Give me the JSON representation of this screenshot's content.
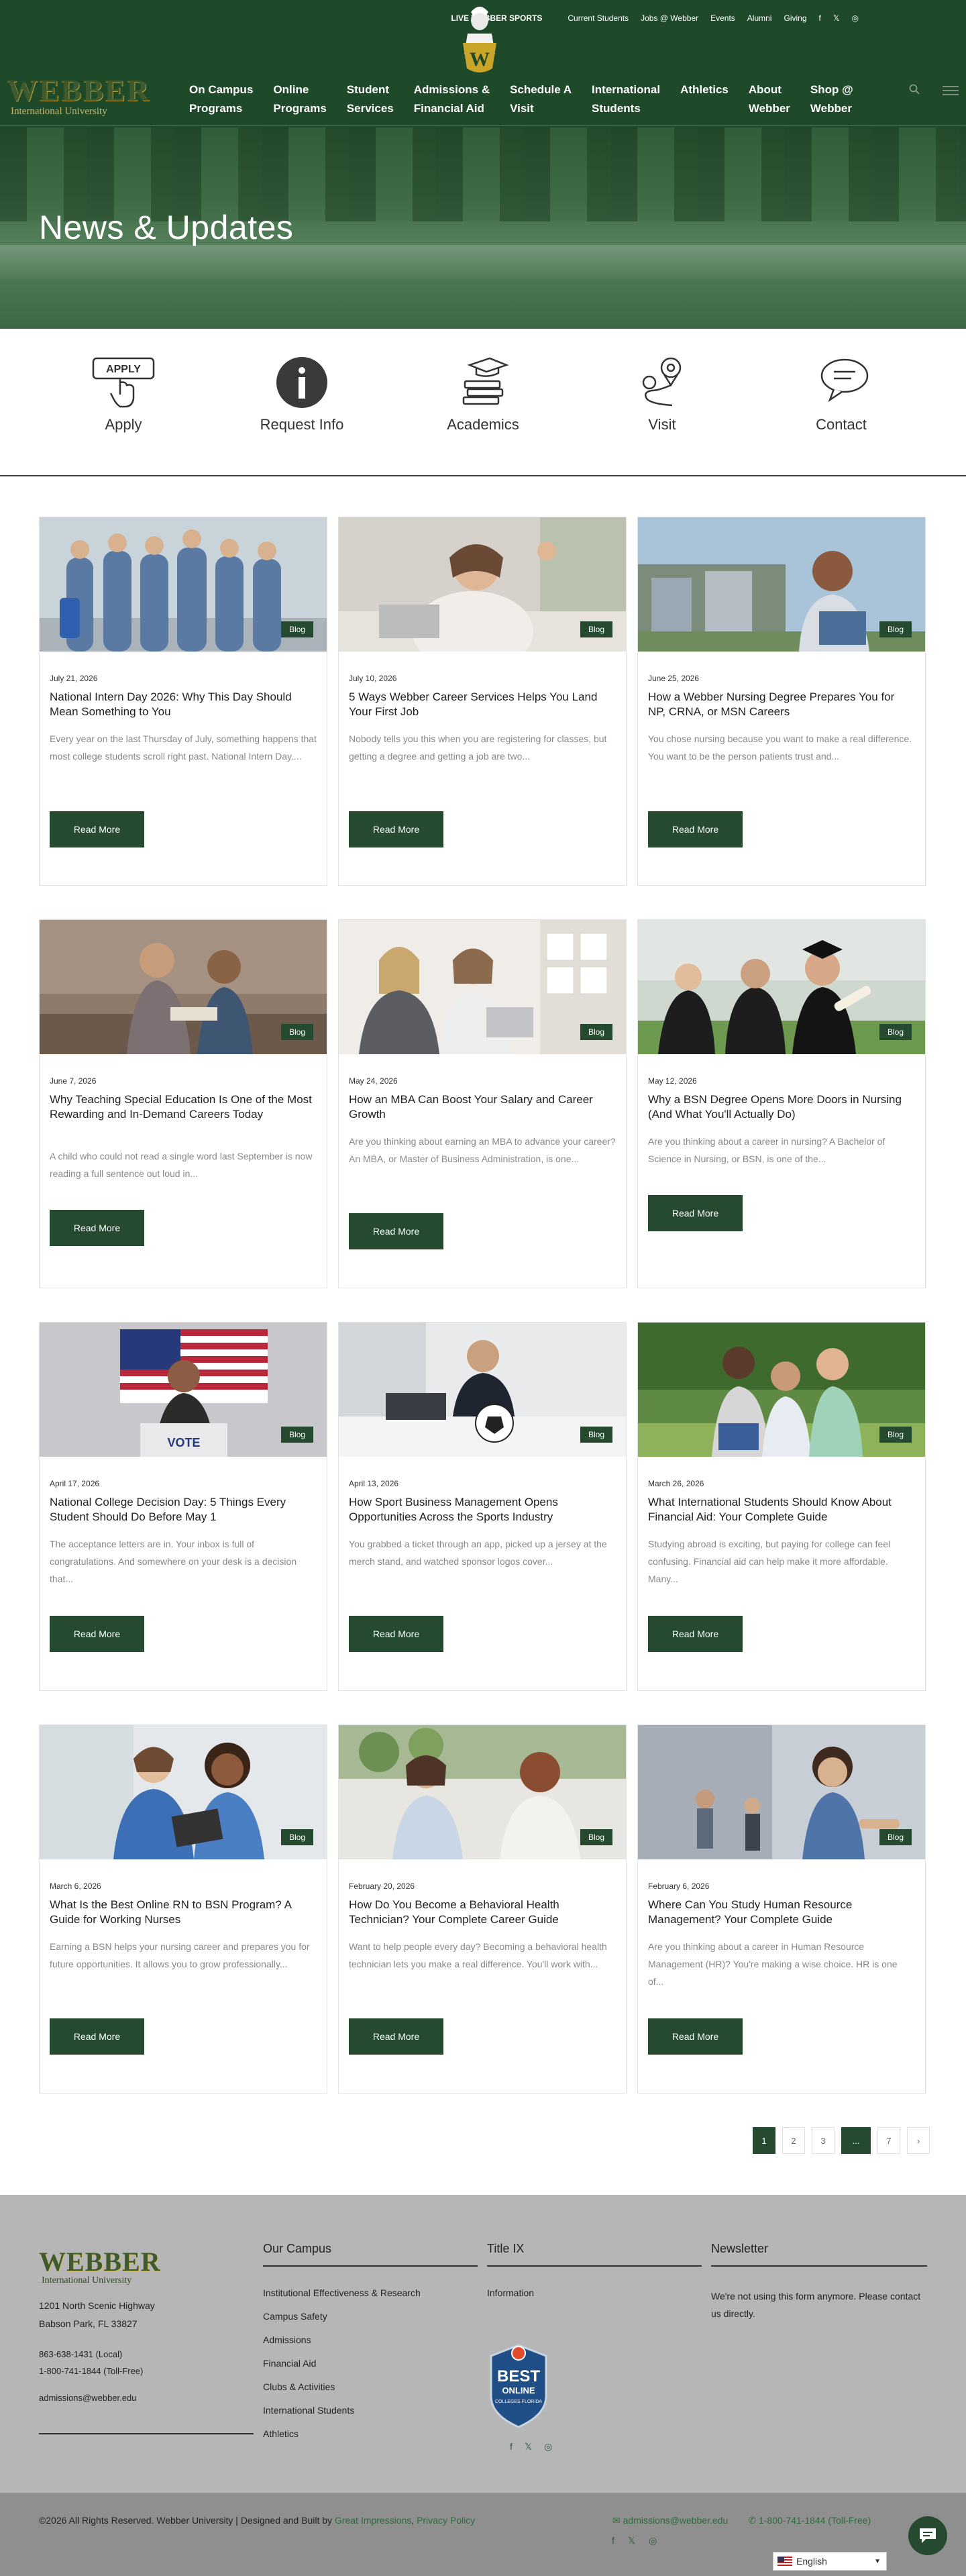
{
  "topbar": {
    "live": "LIVE WEBBER SPORTS",
    "links": [
      "Current Students",
      "Jobs @ Webber",
      "Events",
      "Alumni",
      "Giving"
    ],
    "social": [
      "facebook-icon",
      "twitter-icon",
      "instagram-icon"
    ]
  },
  "logo": {
    "name": "WEBBER",
    "subtitle": "International University"
  },
  "nav": {
    "items": [
      "On Campus\nPrograms",
      "Online\nPrograms",
      "Student\nServices",
      "Admissions &\nFinancial Aid",
      "Schedule A\nVisit",
      "International\nStudents",
      "Athletics",
      "About\nWebber",
      "Shop @\nWebber"
    ]
  },
  "hero": {
    "title": "News & Updates"
  },
  "quick_links": [
    {
      "label": "Apply",
      "icon": "apply-hand-icon",
      "badge": "APPLY"
    },
    {
      "label": "Request Info",
      "icon": "info-icon"
    },
    {
      "label": "Academics",
      "icon": "books-mortarboard-icon"
    },
    {
      "label": "Visit",
      "icon": "map-pin-icon"
    },
    {
      "label": "Contact",
      "icon": "chat-bubbles-icon"
    }
  ],
  "cards": [
    {
      "date": "July 21, 2026",
      "title": "National Intern Day 2026: Why This Day Should Mean Something to You",
      "excerpt": "Every year on the last Thursday of July, something happens that most college students scroll right past. National Intern Day....",
      "tag": "Blog",
      "button": "Read More"
    },
    {
      "date": "July 10, 2026",
      "title": "5 Ways Webber Career Services Helps You Land Your First Job",
      "excerpt": "Nobody tells you this when you are registering for classes, but getting a degree and getting a job are two...",
      "tag": "Blog",
      "button": "Read More"
    },
    {
      "date": "June 25, 2026",
      "title": "How a Webber Nursing Degree Prepares You for NP, CRNA, or MSN Careers",
      "excerpt": "You chose nursing because you want to make a real difference. You want to be the person patients trust and...",
      "tag": "Blog",
      "button": "Read More"
    },
    {
      "date": "June 7, 2026",
      "title": "Why Teaching Special Education Is One of the Most Rewarding and In-Demand Careers Today",
      "excerpt": "A child who could not read a single word last September is now reading a full sentence out loud in...",
      "tag": "Blog",
      "button": "Read More"
    },
    {
      "date": "May 24, 2026",
      "title": "How an MBA Can Boost Your Salary and Career Growth",
      "excerpt": "Are you thinking about earning an MBA to advance your career? An MBA, or Master of Business Administration, is one...",
      "tag": "Blog",
      "button": "Read More"
    },
    {
      "date": "May 12, 2026",
      "title": "Why a BSN Degree Opens More Doors in Nursing (And What You'll Actually Do)",
      "excerpt": "Are you thinking about a career in nursing? A Bachelor of Science in Nursing, or BSN, is one of the...",
      "tag": "Blog",
      "button": "Read More"
    },
    {
      "date": "April 17, 2026",
      "title": "National College Decision Day: 5 Things Every Student Should Do Before May 1",
      "excerpt": "The acceptance letters are in. Your inbox is full of congratulations. And somewhere on your desk is a decision that...",
      "tag": "Blog",
      "button": "Read More"
    },
    {
      "date": "April 13, 2026",
      "title": "How Sport Business Management Opens Opportunities Across the Sports Industry",
      "excerpt": "You grabbed a ticket through an app, picked up a jersey at the merch stand, and watched sponsor logos cover...",
      "tag": "Blog",
      "button": "Read More"
    },
    {
      "date": "March 26, 2026",
      "title": "What International Students Should Know About Financial Aid: Your Complete Guide",
      "excerpt": "Studying abroad is exciting, but paying for college can feel confusing. Financial aid can help make it more affordable. Many...",
      "tag": "Blog",
      "button": "Read More"
    },
    {
      "date": "March 6, 2026",
      "title": "What Is the Best Online RN to BSN Program? A Guide for Working Nurses",
      "excerpt": "Earning a BSN helps your nursing career and prepares you for future opportunities. It allows you to grow professionally...",
      "tag": "Blog",
      "button": "Read More"
    },
    {
      "date": "February 20, 2026",
      "title": "How Do You Become a Behavioral Health Technician? Your Complete Career Guide",
      "excerpt": "Want to help people every day? Becoming a behavioral health technician lets you make a real difference. You'll work with...",
      "tag": "Blog",
      "button": "Read More"
    },
    {
      "date": "February 6, 2026",
      "title": "Where Can You Study Human Resource Management? Your Complete Guide",
      "excerpt": "Are you thinking about a career in Human Resource Management (HR)? You're making a wise choice. HR is one of...",
      "tag": "Blog",
      "button": "Read More"
    }
  ],
  "pagination": {
    "pages": [
      "1",
      "2",
      "3",
      "...",
      "7"
    ],
    "current": "1",
    "next": "›"
  },
  "footer": {
    "logo_name": "WEBBER",
    "logo_subtitle": "International University",
    "address1": "1201 North Scenic Highway",
    "address2": "Babson Park, FL 33827",
    "phone_local": "863-638-1431 (Local)",
    "phone_tollfree": "1-800-741-1844 (Toll-Free)",
    "email": "admissions@webber.edu",
    "campus_heading": "Our Campus",
    "campus_links": [
      "Institutional Effectiveness & Research",
      "Campus Safety",
      "Admissions",
      "Financial Aid",
      "Clubs & Activities",
      "International Students",
      "Athletics"
    ],
    "title9_heading": "Title IX",
    "title9_links": [
      "Information"
    ],
    "badge": {
      "top": "BEST",
      "mid": "ONLINE",
      "bottom": "COLLEGES\nFLORIDA"
    },
    "newsletter_heading": "Newsletter",
    "newsletter_text": "We're not using this form anymore. Please contact us directly."
  },
  "bottom": {
    "copyright": "©2026 All Rights Reserved. Webber University | Designed and Built by ",
    "designer": "Great Impressions",
    "privacy": "Privacy Policy",
    "email": "admissions@webber.edu",
    "phone": "1-800-741-1844 (Toll-Free)",
    "language": "English"
  },
  "colors": {
    "brand_green": "#254a30",
    "header_green": "#1f4a2a",
    "footer_gray": "#b6b6b6"
  }
}
